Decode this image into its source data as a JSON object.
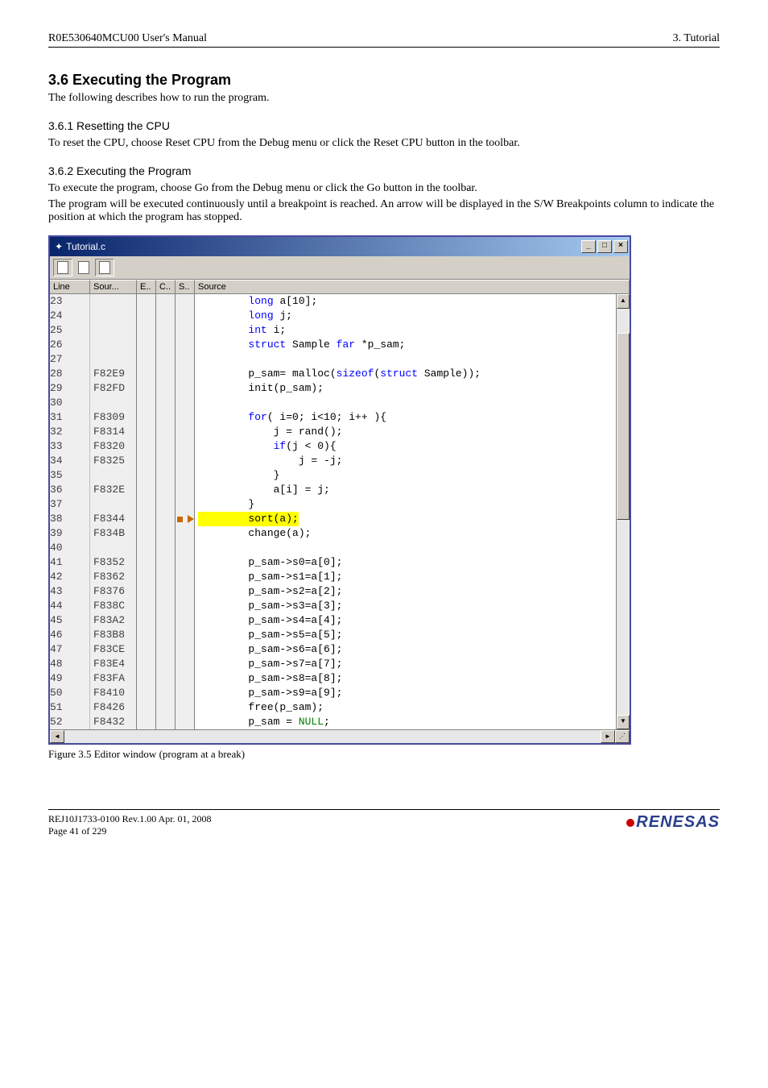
{
  "header": {
    "left": "R0E530640MCU00 User's Manual",
    "right": "3. Tutorial"
  },
  "section36": {
    "title": "3.6 Executing the Program",
    "intro": "The following describes how to run the program."
  },
  "section361": {
    "title": "3.6.1 Resetting the CPU",
    "body": "To reset the CPU, choose Reset CPU from the Debug menu or click the Reset CPU button in the toolbar."
  },
  "section362": {
    "title": "3.6.2 Executing the Program",
    "body1": "To execute the program, choose Go from the Debug menu or click the Go button in the toolbar.",
    "body2": "The program will be executed continuously until a breakpoint is reached. An arrow will be displayed in the S/W Breakpoints column to indicate the position at which the program has stopped."
  },
  "editor": {
    "title": "Tutorial.c",
    "columns": {
      "line": "Line",
      "sour": "Sour...",
      "e": "E..",
      "c": "C..",
      "s": "S..",
      "source": "Source"
    },
    "rows": [
      {
        "line": "23",
        "addr": "",
        "bp": "",
        "src": "        long a[10];"
      },
      {
        "line": "24",
        "addr": "",
        "bp": "",
        "src": "        long j;"
      },
      {
        "line": "25",
        "addr": "",
        "bp": "",
        "src": "        int i;"
      },
      {
        "line": "26",
        "addr": "",
        "bp": "",
        "src": "        struct Sample far *p_sam;"
      },
      {
        "line": "27",
        "addr": "",
        "bp": "",
        "src": ""
      },
      {
        "line": "28",
        "addr": "F82E9",
        "bp": "",
        "src": "        p_sam= malloc(sizeof(struct Sample));"
      },
      {
        "line": "29",
        "addr": "F82FD",
        "bp": "",
        "src": "        init(p_sam);"
      },
      {
        "line": "30",
        "addr": "",
        "bp": "",
        "src": ""
      },
      {
        "line": "31",
        "addr": "F8309",
        "bp": "",
        "src": "        for( i=0; i<10; i++ ){"
      },
      {
        "line": "32",
        "addr": "F8314",
        "bp": "",
        "src": "            j = rand();"
      },
      {
        "line": "33",
        "addr": "F8320",
        "bp": "",
        "src": "            if(j < 0){"
      },
      {
        "line": "34",
        "addr": "F8325",
        "bp": "",
        "src": "                j = -j;"
      },
      {
        "line": "35",
        "addr": "",
        "bp": "",
        "src": "            }"
      },
      {
        "line": "36",
        "addr": "F832E",
        "bp": "",
        "src": "            a[i] = j;"
      },
      {
        "line": "37",
        "addr": "",
        "bp": "",
        "src": "        }"
      },
      {
        "line": "38",
        "addr": "F8344",
        "bp": "arrow",
        "src": "        sort(a);",
        "hl": true
      },
      {
        "line": "39",
        "addr": "F834B",
        "bp": "",
        "src": "        change(a);"
      },
      {
        "line": "40",
        "addr": "",
        "bp": "",
        "src": ""
      },
      {
        "line": "41",
        "addr": "F8352",
        "bp": "",
        "src": "        p_sam->s0=a[0];"
      },
      {
        "line": "42",
        "addr": "F8362",
        "bp": "",
        "src": "        p_sam->s1=a[1];"
      },
      {
        "line": "43",
        "addr": "F8376",
        "bp": "",
        "src": "        p_sam->s2=a[2];"
      },
      {
        "line": "44",
        "addr": "F838C",
        "bp": "",
        "src": "        p_sam->s3=a[3];"
      },
      {
        "line": "45",
        "addr": "F83A2",
        "bp": "",
        "src": "        p_sam->s4=a[4];"
      },
      {
        "line": "46",
        "addr": "F83B8",
        "bp": "",
        "src": "        p_sam->s5=a[5];"
      },
      {
        "line": "47",
        "addr": "F83CE",
        "bp": "",
        "src": "        p_sam->s6=a[6];"
      },
      {
        "line": "48",
        "addr": "F83E4",
        "bp": "",
        "src": "        p_sam->s7=a[7];"
      },
      {
        "line": "49",
        "addr": "F83FA",
        "bp": "",
        "src": "        p_sam->s8=a[8];"
      },
      {
        "line": "50",
        "addr": "F8410",
        "bp": "",
        "src": "        p_sam->s9=a[9];"
      },
      {
        "line": "51",
        "addr": "F8426",
        "bp": "",
        "src": "        free(p_sam);"
      },
      {
        "line": "52",
        "addr": "F8432",
        "bp": "",
        "src": "        p_sam = NULL;"
      }
    ]
  },
  "figure_caption": "Figure 3.5 Editor window (program at a break)",
  "footer": {
    "left1": "REJ10J1733-0100   Rev.1.00   Apr. 01, 2008",
    "left2": "Page 41 of 229",
    "logo": "RENESAS"
  }
}
